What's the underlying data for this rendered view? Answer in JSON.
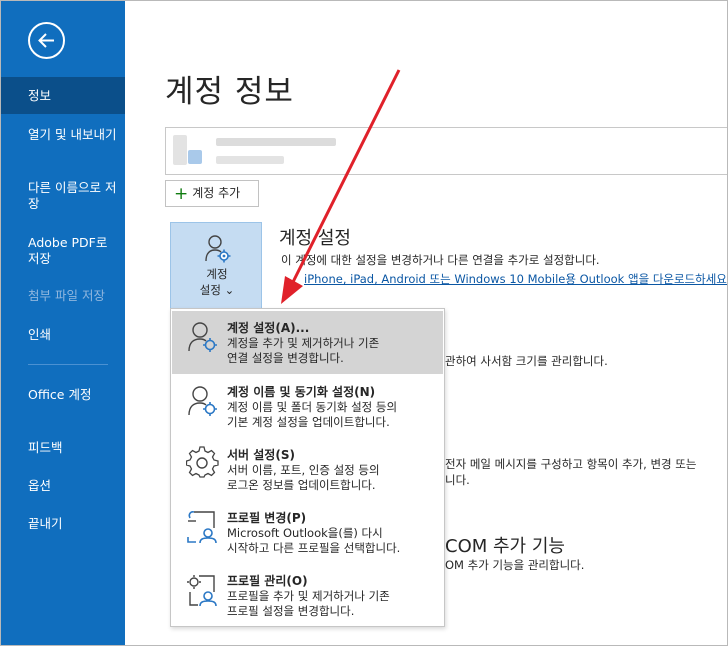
{
  "sidebar": {
    "items": [
      {
        "label": "정보"
      },
      {
        "label": "열기 및 내보내기"
      },
      {
        "label": "다른 이름으로 저장"
      },
      {
        "label": "Adobe PDF로 저장"
      },
      {
        "label": "첨부 파일 저장"
      },
      {
        "label": "인쇄"
      },
      {
        "label": "Office 계정"
      },
      {
        "label": "피드백"
      },
      {
        "label": "옵션"
      },
      {
        "label": "끝내기"
      }
    ]
  },
  "main": {
    "title": "계정 정보",
    "add_account_label": "계정 추가",
    "account_tile": {
      "line1": "계정",
      "line2": "설정 ⌄"
    },
    "account_settings": {
      "heading": "계정 설정",
      "desc": "이 계정에 대한 설정을 변경하거나 다른 연결을 추가로 설정합니다.",
      "link": "iPhone, iPad, Android 또는 Windows 10 Mobile용 Outlook 앱을 다운로드하세요."
    },
    "partial_texts": {
      "mailbox": "관하여 사서함 크기를 관리합니다.",
      "rules1": "전자 메일 메시지를 구성하고 항목이 추가, 변경 또는",
      "rules2": "니다.",
      "com_heading": "COM 추가 기능",
      "com_desc": "OM 추가 기능을 관리합니다."
    }
  },
  "dropdown": {
    "items": [
      {
        "title": "계정 설정(A)...",
        "desc1": "계정을 추가 및 제거하거나 기존",
        "desc2": "연결 설정을 변경합니다.",
        "icon": "account-settings-icon"
      },
      {
        "title": "계정 이름 및 동기화 설정(N)",
        "desc1": "계정 이름 및 폴더 동기화 설정 등의",
        "desc2": "기본 계정 설정을 업데이트합니다.",
        "icon": "account-sync-icon"
      },
      {
        "title": "서버 설정(S)",
        "desc1": "서버 이름, 포트, 인증 설정 등의",
        "desc2": "로그온 정보를 업데이트합니다.",
        "icon": "gear-icon"
      },
      {
        "title": "프로필 변경(P)",
        "desc1": "Microsoft Outlook을(를) 다시",
        "desc2": "시작하고 다른 프로필을 선택합니다.",
        "icon": "change-profile-icon"
      },
      {
        "title": "프로필 관리(O)",
        "desc1": "프로필을 추가 및 제거하거나 기존",
        "desc2": "프로필 설정을 변경합니다.",
        "icon": "manage-profile-icon"
      }
    ]
  },
  "colors": {
    "sidebar": "#106ebe",
    "sidebar_active": "#0b4f8a",
    "highlight": "#d4d4d4",
    "arrow": "#e0212a"
  }
}
